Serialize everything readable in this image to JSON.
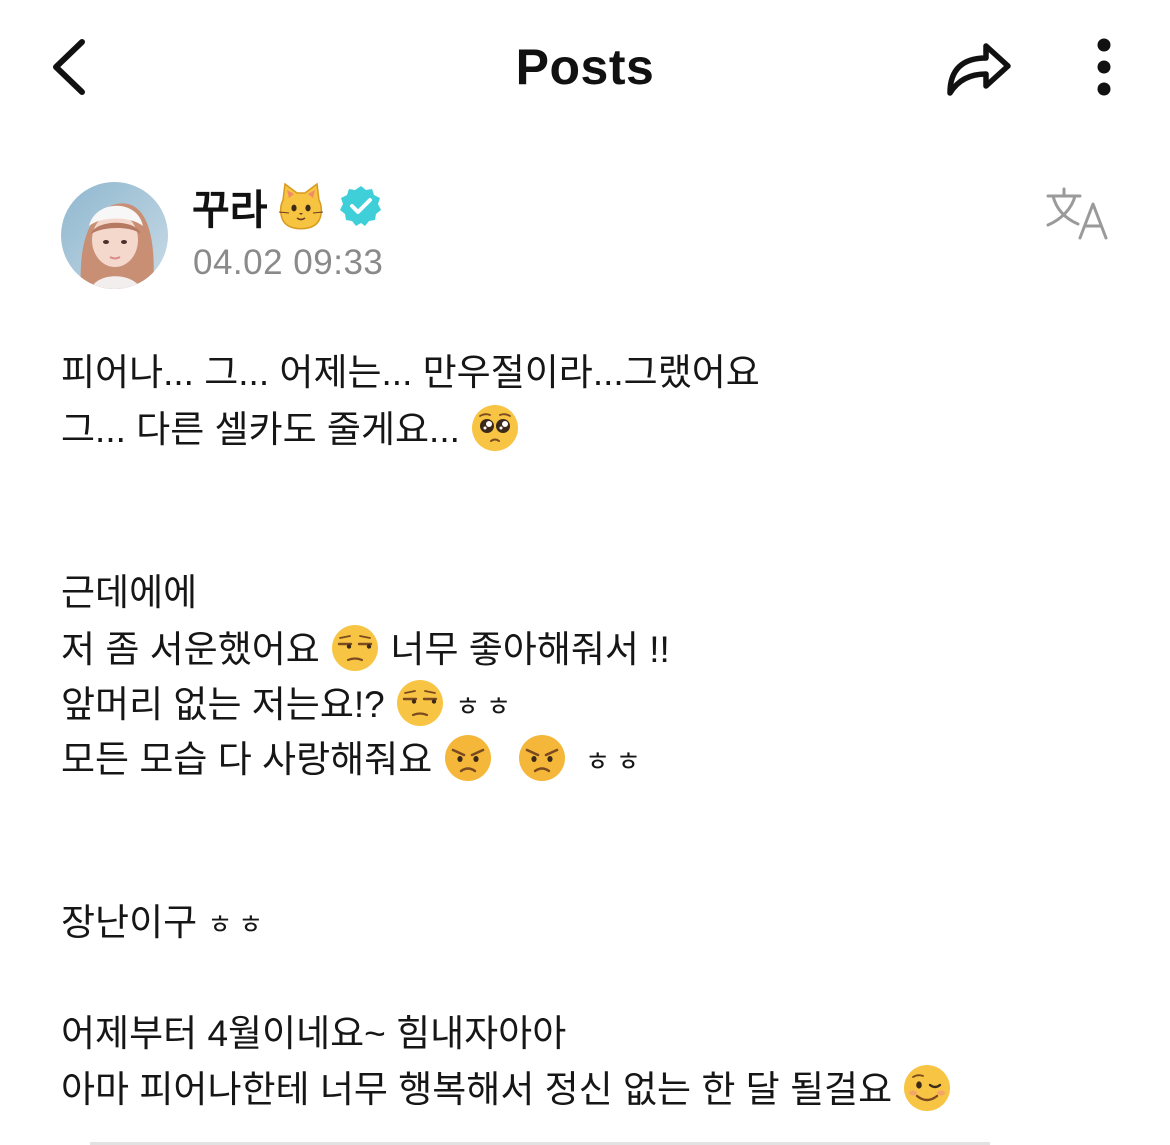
{
  "header": {
    "title": "Posts"
  },
  "post": {
    "author_name": "꾸라",
    "timestamp": "04.02 09:33",
    "lines": [
      "피어나... 그... 어제는... 만우절이라...그랬어요",
      "그... 다른 셀카도 줄게요...",
      "근데에에",
      "저 좀 서운했어요",
      "너무 좋아해줘서 !!",
      "앞머리 없는 저는요!?",
      "ㅎㅎ",
      "모든 모습 다 사랑해줘요",
      "ㅎㅎ",
      "장난이구",
      "ㅎㅎ",
      "어제부터 4월이네요~ 힘내자아아",
      "아마 피어나한테 너무 행복해서 정신 없는 한 달 될걸요"
    ]
  },
  "icons": {
    "back": "chevron-left-icon",
    "share": "share-arrow-icon",
    "more": "more-vertical-icon",
    "translate": "translate-icon",
    "verified": "verified-badge-icon",
    "cat": "cat-face-emoji"
  },
  "colors": {
    "verified": "#3fcfd9",
    "timestamp": "#8a8a8a",
    "text": "#161616"
  }
}
